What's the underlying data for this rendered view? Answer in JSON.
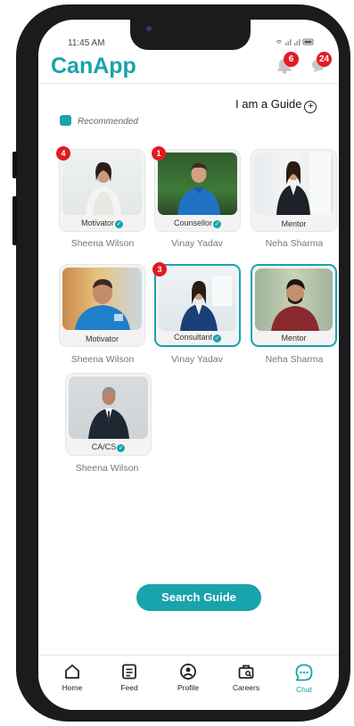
{
  "status_bar": {
    "time": "11:45 AM"
  },
  "app": {
    "title": "CanApp"
  },
  "header": {
    "notifications_count": "6",
    "messages_count": "24"
  },
  "guide_toggle": {
    "label": "I am a Guide",
    "icon": "plus-circle-icon"
  },
  "legend": {
    "label": "Recommended",
    "color": "#19a3ac"
  },
  "guides": [
    {
      "role": "Motivator",
      "verified": true,
      "name": "Sheena Wilson",
      "badge": "4",
      "selected": false
    },
    {
      "role": "Counsellor",
      "verified": true,
      "name": "Vinay Yadav",
      "badge": "1",
      "selected": false
    },
    {
      "role": "Mentor",
      "verified": false,
      "name": "Neha Sharma",
      "badge": "",
      "selected": false
    },
    {
      "role": "Motivator",
      "verified": false,
      "name": "Sheena Wilson",
      "badge": "",
      "selected": false
    },
    {
      "role": "Consultant",
      "verified": true,
      "name": "Vinay Yadav",
      "badge": "3",
      "selected": true
    },
    {
      "role": "Mentor",
      "verified": false,
      "name": "Neha Sharma",
      "badge": "",
      "selected": true
    },
    {
      "role": "CA/CS",
      "verified": true,
      "name": "Sheena Wilson",
      "badge": "",
      "selected": false
    }
  ],
  "search_button": {
    "label": "Search Guide"
  },
  "tabs": [
    {
      "label": "Home",
      "icon": "home-icon"
    },
    {
      "label": "Feed",
      "icon": "feed-icon"
    },
    {
      "label": "Profile",
      "icon": "profile-icon"
    },
    {
      "label": "Careers",
      "icon": "careers-icon"
    },
    {
      "label": "Chat",
      "icon": "chat-icon",
      "active": true
    }
  ],
  "colors": {
    "accent": "#19a3ac",
    "badge": "#e11b22"
  }
}
